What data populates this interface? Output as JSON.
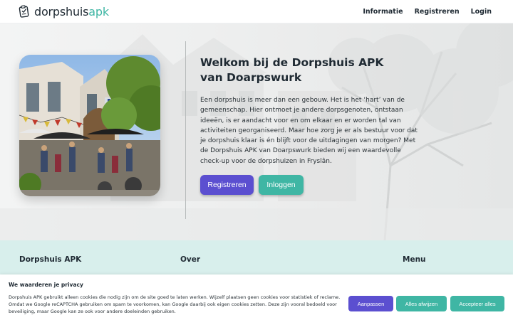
{
  "header": {
    "logo_main": "dorpshuis",
    "logo_accent": "apk",
    "nav": [
      {
        "label": "Informatie"
      },
      {
        "label": "Registreren"
      },
      {
        "label": "Login"
      }
    ]
  },
  "hero": {
    "title_line1": "Welkom bij de Dorpshuis APK",
    "title_line2": "van Doarpswurk",
    "text": "Een dorpshuis is meer dan een gebouw. Het is het ‘hart’ van de gemeenschap. Hier ontmoet je andere dorpsgenoten, ontstaan ideeën, is er aandacht voor en om elkaar en er worden tal van activiteiten georganiseerd. Maar hoe zorg je er als bestuur voor dat je dorpshuis klaar is én blijft voor de uitdagingen van morgen? Met de Dorpshuis APK van Doarpswurk bieden wij een waardevolle check-up voor de dorpshuizen in Fryslân.",
    "register_button": "Registreren",
    "login_button": "Inloggen"
  },
  "footer": {
    "col1_title": "Dorpshuis APK",
    "col2_title": "Over",
    "col3_title": "Menu"
  },
  "cookie": {
    "title": "We waarderen je privacy",
    "text": "Dorpshuis APK gebruikt alleen cookies die nodig zijn om de site goed te laten werken. Wijzelf plaatsen geen cookies voor statistiek of reclame. Omdat we Google reCAPTCHA gebruiken om spam te voorkomen, kan Google daarbij ook eigen cookies zetten. Deze zijn vooral bedoeld voor beveiliging, maar Google kan ze ook voor andere doeleinden gebruiken.",
    "adjust_button": "Aanpassen",
    "reject_button": "Alles afwijzen",
    "accept_button": "Accepteer alles"
  },
  "colors": {
    "accent_teal": "#3fb6a4",
    "accent_purple": "#5b4fd0",
    "footer_bg": "#d8efec"
  }
}
